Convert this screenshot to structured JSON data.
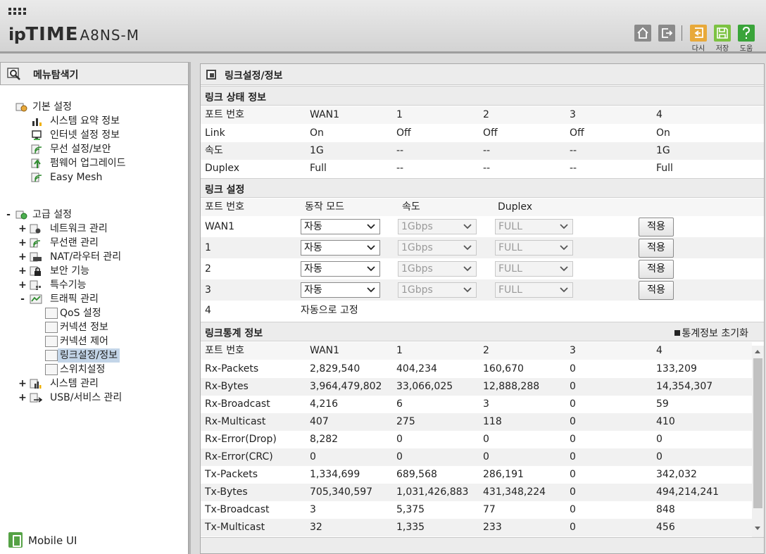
{
  "header": {
    "logo_ip": "ip",
    "logo_time": "TIME",
    "model": "A8NS-M",
    "buttons": {
      "home_icon": "home-icon",
      "logout_icon": "logout-icon",
      "reload_label": "다시",
      "save_label": "저장",
      "help_label": "도움"
    },
    "colors": {
      "reload": "#e8a93a",
      "save": "#7cc242",
      "help": "#3aa43a"
    }
  },
  "sidebar": {
    "title": "메뉴탐색기",
    "basic": {
      "label": "기본 설정",
      "items": [
        "시스템 요약 정보",
        "인터넷 설정 정보",
        "무선 설정/보안",
        "펌웨어 업그레이드",
        "Easy Mesh"
      ]
    },
    "advanced": {
      "label": "고급 설정",
      "expander": "-",
      "items": [
        {
          "label": "네트워크 관리",
          "expander": "+"
        },
        {
          "label": "무선랜 관리",
          "expander": "+"
        },
        {
          "label": "NAT/라우터 관리",
          "expander": "+"
        },
        {
          "label": "보안 기능",
          "expander": "+"
        },
        {
          "label": "특수기능",
          "expander": "+"
        },
        {
          "label": "트래픽 관리",
          "expander": "-"
        },
        {
          "label": "시스템 관리",
          "expander": "+"
        },
        {
          "label": "USB/서비스 관리",
          "expander": "+"
        }
      ],
      "traffic_children": [
        "QoS 설정",
        "커넥션 정보",
        "커넥션 제어",
        "링크설정/정보",
        "스위치설정"
      ],
      "selected": "링크설정/정보"
    },
    "mobile_ui": "Mobile UI"
  },
  "main": {
    "title": "링크설정/정보",
    "status": {
      "section": "링크 상태 정보",
      "headers": [
        "포트 번호",
        "WAN1",
        "1",
        "2",
        "3",
        "4"
      ],
      "rows": [
        [
          "Link",
          "On",
          "Off",
          "Off",
          "Off",
          "On"
        ],
        [
          "속도",
          "1G",
          "--",
          "--",
          "--",
          "1G"
        ],
        [
          "Duplex",
          "Full",
          "--",
          "--",
          "--",
          "Full"
        ]
      ]
    },
    "config": {
      "section": "링크 설정",
      "headers": [
        "포트 번호",
        "동작 모드",
        "속도",
        "Duplex"
      ],
      "rows": [
        {
          "port": "WAN1",
          "mode": "자동",
          "speed": "1Gbps",
          "duplex": "FULL",
          "apply": "적용"
        },
        {
          "port": "1",
          "mode": "자동",
          "speed": "1Gbps",
          "duplex": "FULL",
          "apply": "적용"
        },
        {
          "port": "2",
          "mode": "자동",
          "speed": "1Gbps",
          "duplex": "FULL",
          "apply": "적용"
        },
        {
          "port": "3",
          "mode": "자동",
          "speed": "1Gbps",
          "duplex": "FULL",
          "apply": "적용"
        }
      ],
      "fixed_row": {
        "port": "4",
        "text": "자동으로 고정"
      }
    },
    "stats": {
      "section": "링크통계 정보",
      "reset_label": "통계정보 초기화",
      "headers": [
        "포트 번호",
        "WAN1",
        "1",
        "2",
        "3",
        "4"
      ],
      "rows": [
        [
          "Rx-Packets",
          "2,829,540",
          "404,234",
          "160,670",
          "0",
          "133,209"
        ],
        [
          "Rx-Bytes",
          "3,964,479,802",
          "33,066,025",
          "12,888,288",
          "0",
          "14,354,307"
        ],
        [
          "Rx-Broadcast",
          "4,216",
          "6",
          "3",
          "0",
          "59"
        ],
        [
          "Rx-Multicast",
          "407",
          "275",
          "118",
          "0",
          "410"
        ],
        [
          "Rx-Error(Drop)",
          "8,282",
          "0",
          "0",
          "0",
          "0"
        ],
        [
          "Rx-Error(CRC)",
          "0",
          "0",
          "0",
          "0",
          "0"
        ],
        [
          "Tx-Packets",
          "1,334,699",
          "689,568",
          "286,191",
          "0",
          "342,032"
        ],
        [
          "Tx-Bytes",
          "705,340,597",
          "1,031,426,883",
          "431,348,224",
          "0",
          "494,214,241"
        ],
        [
          "Tx-Broadcast",
          "3",
          "5,375",
          "77",
          "0",
          "848"
        ],
        [
          "Tx-Multicast",
          "32",
          "1,335",
          "233",
          "0",
          "456"
        ]
      ]
    }
  }
}
